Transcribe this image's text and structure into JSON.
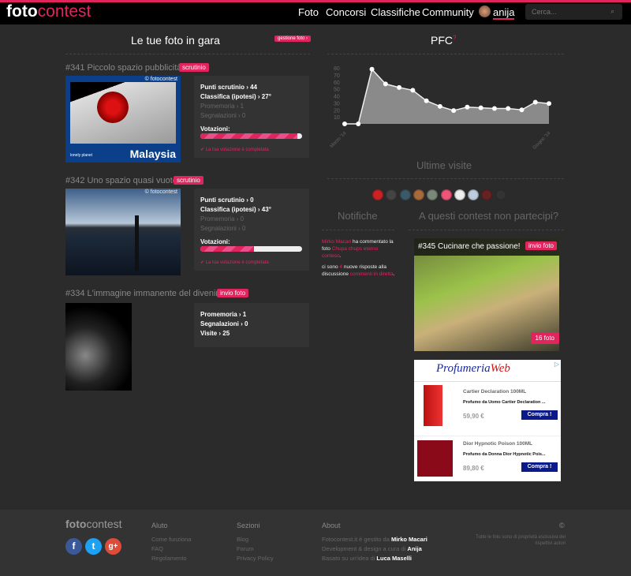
{
  "header": {
    "logo_a": "foto",
    "logo_b": "contest",
    "nav": [
      "Foto",
      "Concorsi",
      "Classifiche",
      "Community"
    ],
    "user": "anija",
    "search_placeholder": "Cerca...",
    "search_icon": "magnifier-icon"
  },
  "left": {
    "title": "Le tue foto in gara",
    "manage": "gestione foto ›",
    "photos": [
      {
        "title": "#341 Piccolo spazio pubblicità",
        "badge": "scrutinio",
        "watermark": "© fotocontest",
        "caption": "Malaysia",
        "brand": "lonely planet",
        "stats": [
          "Punti scrutinio › 44",
          "Classifica (ipotesi) › 27°",
          "Promemoria › 1",
          "Segnalazioni › 0"
        ],
        "vote_label": "Votazioni:",
        "vote_progress": 95,
        "vote_done": "✔ La tua votazione è completata"
      },
      {
        "title": "#342 Uno spazio quasi vuoto",
        "badge": "scrutinio",
        "watermark": "© fotocontest",
        "stats": [
          "Punti scrutinio › 0",
          "Classifica (ipotesi) › 43°",
          "Promemoria › 0",
          "Segnalazioni › 0"
        ],
        "vote_label": "Votazioni:",
        "vote_progress": 53,
        "vote_done": "✔ La tua votazione è completata"
      },
      {
        "title": "#334 L'immagine immanente del divenire",
        "badge": "invio foto",
        "stats": [
          "Promemoria › 1",
          "Segnalazioni › 0",
          "Visite › 25"
        ]
      }
    ]
  },
  "pfc": {
    "title": "PFC",
    "help": "?"
  },
  "chart_data": {
    "type": "area",
    "x": [
      "Marzo '14",
      "",
      "",
      "",
      "",
      "",
      "",
      "",
      "",
      "",
      "",
      "",
      "",
      "",
      "",
      "Giugno '14"
    ],
    "values": [
      0,
      0,
      78,
      57,
      52,
      48,
      33,
      25,
      19,
      24,
      23,
      22,
      22,
      20,
      31,
      29
    ],
    "yticks": [
      10,
      20,
      30,
      40,
      50,
      60,
      70,
      80
    ],
    "ylim": [
      0,
      80
    ],
    "xtick_labels": [
      "Marzo '14",
      "Giugno '14"
    ],
    "title": "Ultime visite",
    "fill": "#8a8a8a",
    "line": "#eeeeee"
  },
  "visitors_count": 10,
  "notifications": {
    "title": "Notifiche",
    "items": [
      {
        "a": "Mirko Macari",
        "b": " ha commentato la foto ",
        "c": "Chupa chups eterno conteso",
        "d": "."
      },
      {
        "a": "ci sono ",
        "b": "4",
        "c": " nuove risposte alla discussione ",
        "d": "commenti in diretta",
        "e": "."
      }
    ]
  },
  "contests": {
    "title": "A questi contest non partecipi?",
    "item": {
      "title": "#345 Cucinare che passione!",
      "badge": "invio foto",
      "count": "16 foto"
    }
  },
  "ad": {
    "brand_a": "Profumeria",
    "brand_b": "Web",
    ".com": ".com",
    "products": [
      {
        "name": "Cartier Declaration 100ML",
        "desc": "Profumo da Uomo Cartier Declaration ...",
        "price": "59,90 €",
        "button": "Compra !"
      },
      {
        "name": "Dior Hypnotic Poison 100ML",
        "desc": "Profumo da Donna Dior Hypnotic Pois...",
        "price": "89,80 €",
        "button": "Compra !"
      }
    ]
  },
  "footer": {
    "logo_a": "foto",
    "logo_b": "contest",
    "aiuto": {
      "title": "Aluto",
      "links": [
        "Come funziona",
        "FAQ",
        "Regolamento"
      ]
    },
    "sezioni": {
      "title": "Sezioni",
      "links": [
        "Blog",
        "Forum",
        "Privacy Policy"
      ]
    },
    "about": {
      "title": "About",
      "lines": [
        [
          "Fotocontest.it è gestito da ",
          "Mirko Macari"
        ],
        [
          "Development & design a cura di ",
          "Anija"
        ],
        [
          "Basato su un'idea di ",
          "Luca Maselli"
        ]
      ]
    },
    "copyright": "©",
    "rights": "Tutte le foto sono di proprietà esclusiva dei rispettivi autori"
  },
  "colors": {
    "accent": "#e0245e",
    "background": "#2b2b2b",
    "header": "#000000"
  }
}
